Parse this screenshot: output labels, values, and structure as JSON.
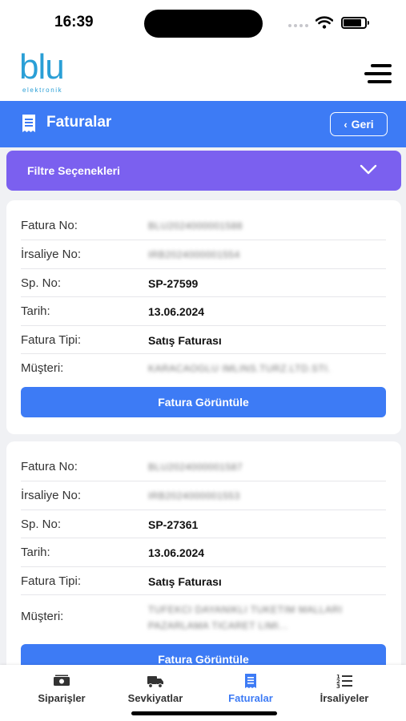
{
  "status_bar": {
    "time": "16:39"
  },
  "app": {
    "logo_text": "blu",
    "logo_sub": "elektronik"
  },
  "page": {
    "title": "Faturalar",
    "back_label": "Geri"
  },
  "filter": {
    "label": "Filtre Seçenekleri"
  },
  "labels": {
    "invoice_no": "Fatura No:",
    "waybill_no": "İrsaliye No:",
    "order_no": "Sp. No:",
    "date": "Tarih:",
    "invoice_type": "Fatura Tipi:",
    "customer": "Müşteri:"
  },
  "invoices": [
    {
      "invoice_no": "BLU2024000001588",
      "waybill_no": "IRB2024000001554",
      "order_no": "SP-27599",
      "date": "13.06.2024",
      "invoice_type": "Satış Faturası",
      "customer": "KARACAOGLU IMLINS.TURZ.LTD.STI.",
      "button_label": "Fatura Görüntüle"
    },
    {
      "invoice_no": "BLU2024000001587",
      "waybill_no": "IRB2024000001553",
      "order_no": "SP-27361",
      "date": "13.06.2024",
      "invoice_type": "Satış Faturası",
      "customer": "TUFEKCI DAYANIKLI TUKETIM MALLARI PAZARLAMA TICARET LIMI...",
      "button_label": "Fatura Görüntüle"
    }
  ],
  "bottom_nav": [
    {
      "label": "Siparişler",
      "icon": "money-icon",
      "active": false
    },
    {
      "label": "Sevkiyatlar",
      "icon": "truck-icon",
      "active": false
    },
    {
      "label": "Faturalar",
      "icon": "receipt-icon",
      "active": true
    },
    {
      "label": "İrsaliyeler",
      "icon": "numbered-list-icon",
      "active": false
    }
  ],
  "colors": {
    "primary": "#3d7bf5",
    "filter": "#7b60ef",
    "logo": "#2a9fd6",
    "background": "#f0f1f4"
  }
}
